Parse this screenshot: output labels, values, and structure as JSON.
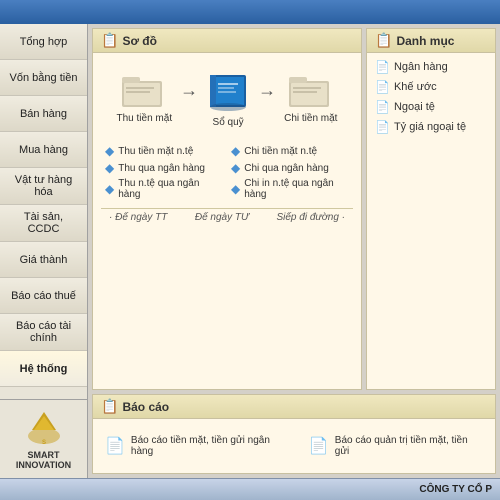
{
  "topBar": {
    "title": ""
  },
  "sidebar": {
    "items": [
      {
        "id": "tong-hop",
        "label": "Tổng hợp"
      },
      {
        "id": "von-bang-tien",
        "label": "Vốn bằng tiền"
      },
      {
        "id": "ban-hang",
        "label": "Bán hàng"
      },
      {
        "id": "mua-hang",
        "label": "Mua hàng"
      },
      {
        "id": "vat-tu-hang-hoa",
        "label": "Vật tư hàng hóa"
      },
      {
        "id": "tai-san-ccdc",
        "label": "Tài sản, CCDC"
      },
      {
        "id": "gia-thanh",
        "label": "Giá thành"
      },
      {
        "id": "bao-cao-thue",
        "label": "Báo cáo thuế"
      },
      {
        "id": "bao-cao-tai-chinh",
        "label": "Báo cáo tài chính"
      },
      {
        "id": "he-thong",
        "label": "Hệ thống",
        "active": true
      }
    ],
    "logoText": "SMART INNOVATION"
  },
  "soDo": {
    "panelTitle": "Sơ đồ",
    "flowItems": [
      {
        "id": "thu-tien-mat",
        "label": "Thu tiền mặt"
      },
      {
        "id": "so-quy",
        "label": "Sổ quỹ"
      },
      {
        "id": "chi-tien-mat",
        "label": "Chi tiền mặt"
      }
    ],
    "subItems": [
      {
        "id": "thu-tien-mat-nte",
        "label": "Thu tiền mặt n.tệ"
      },
      {
        "id": "chi-tien-mat-nte",
        "label": "Chi tiền mặt n.tệ"
      },
      {
        "id": "thu-qua-ngan-hang",
        "label": "Thu qua ngân hàng"
      },
      {
        "id": "chi-qua-ngan-hang",
        "label": "Chi qua ngân hàng"
      },
      {
        "id": "thu-nte-qua-ngan-hang",
        "label": "Thu n.tệ qua ngân hàng"
      },
      {
        "id": "chi-in-nte-qua-ngan-hang",
        "label": "Chi in n.tệ qua ngân hàng"
      }
    ],
    "footerLabels": [
      "· Đế ngày TT",
      "Đế ngày TƯ",
      "Siếp đi đường ·"
    ]
  },
  "danhMuc": {
    "panelTitle": "Danh mục",
    "items": [
      {
        "id": "ngan-hang",
        "label": "Ngân hàng"
      },
      {
        "id": "khe-uoc",
        "label": "Khế ước"
      },
      {
        "id": "ngoai-te",
        "label": "Ngoại tệ"
      },
      {
        "id": "ty-gia-ngoai-te",
        "label": "Tỷ giá ngoại tệ"
      }
    ]
  },
  "baoCao": {
    "panelTitle": "Báo cáo",
    "items": [
      {
        "id": "bao-cao-tien-mat",
        "label": "Báo cáo tiền mặt, tiền gửi ngân hàng"
      },
      {
        "id": "bao-cao-quan-tri",
        "label": "Báo cáo quản trị tiền mặt, tiền gửi"
      }
    ]
  },
  "bottomBar": {
    "text": "CÔNG TY CỔ P"
  }
}
